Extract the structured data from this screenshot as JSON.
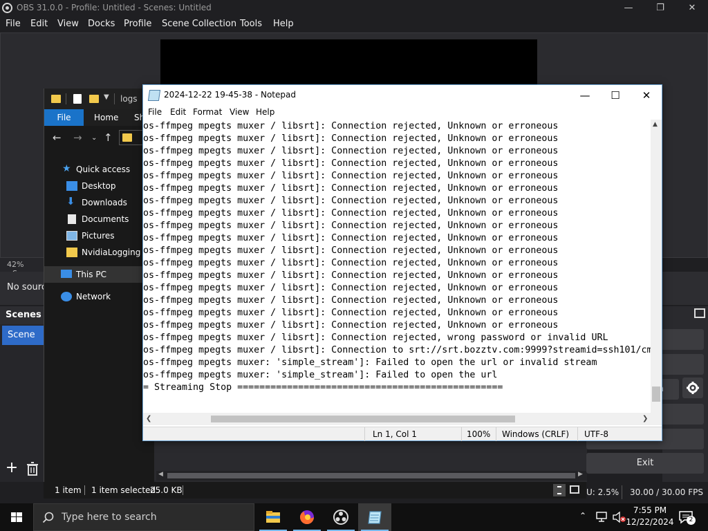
{
  "obs": {
    "title": "OBS 31.0.0 - Profile: Untitled - Scenes: Untitled",
    "menu": [
      "File",
      "Edit",
      "View",
      "Docks",
      "Profile",
      "Scene Collection",
      "Tools",
      "Help"
    ],
    "zoom": "42%",
    "zoom_suffix": "Sca",
    "no_source": "No sourc",
    "scenes_header": "Scenes",
    "scene_item": "Scene",
    "controls": {
      "btn1": "g",
      "btn2": "g",
      "btn3": "a",
      "exit": "Exit"
    },
    "status": {
      "cpu": "U: 2.5%",
      "fps": "30.00 / 30.00 FPS"
    }
  },
  "explorer": {
    "path": "logs",
    "tabs": {
      "file": "File",
      "home": "Home",
      "share": "Sh"
    },
    "nav": [
      {
        "label": "Quick access",
        "icon": "star-icon"
      },
      {
        "label": "Desktop",
        "icon": "desktop-icon"
      },
      {
        "label": "Downloads",
        "icon": "download-icon"
      },
      {
        "label": "Documents",
        "icon": "document-icon"
      },
      {
        "label": "Pictures",
        "icon": "picture-icon"
      },
      {
        "label": "NvidiaLogging",
        "icon": "folder-icon"
      },
      {
        "label": "This PC",
        "icon": "computer-icon"
      },
      {
        "label": "Network",
        "icon": "network-icon"
      }
    ],
    "status": {
      "count": "1 item",
      "selected": "1 item selected",
      "size": "25.0 KB"
    }
  },
  "notepad": {
    "title": "2024-12-22 19-45-38 - Notepad",
    "menu": [
      "File",
      "Edit",
      "Format",
      "View",
      "Help"
    ],
    "lines": [
      "os-ffmpeg mpegts muxer / libsrt]: Connection rejected, Unknown or erroneous",
      "os-ffmpeg mpegts muxer / libsrt]: Connection rejected, Unknown or erroneous",
      "os-ffmpeg mpegts muxer / libsrt]: Connection rejected, Unknown or erroneous",
      "os-ffmpeg mpegts muxer / libsrt]: Connection rejected, Unknown or erroneous",
      "os-ffmpeg mpegts muxer / libsrt]: Connection rejected, Unknown or erroneous",
      "os-ffmpeg mpegts muxer / libsrt]: Connection rejected, Unknown or erroneous",
      "os-ffmpeg mpegts muxer / libsrt]: Connection rejected, Unknown or erroneous",
      "os-ffmpeg mpegts muxer / libsrt]: Connection rejected, Unknown or erroneous",
      "os-ffmpeg mpegts muxer / libsrt]: Connection rejected, Unknown or erroneous",
      "os-ffmpeg mpegts muxer / libsrt]: Connection rejected, Unknown or erroneous",
      "os-ffmpeg mpegts muxer / libsrt]: Connection rejected, Unknown or erroneous",
      "os-ffmpeg mpegts muxer / libsrt]: Connection rejected, Unknown or erroneous",
      "os-ffmpeg mpegts muxer / libsrt]: Connection rejected, Unknown or erroneous",
      "os-ffmpeg mpegts muxer / libsrt]: Connection rejected, Unknown or erroneous",
      "os-ffmpeg mpegts muxer / libsrt]: Connection rejected, Unknown or erroneous",
      "os-ffmpeg mpegts muxer / libsrt]: Connection rejected, Unknown or erroneous",
      "os-ffmpeg mpegts muxer / libsrt]: Connection rejected, Unknown or erroneous",
      "os-ffmpeg mpegts muxer / libsrt]: Connection rejected, wrong password or invalid URL",
      "os-ffmpeg mpegts muxer / libsrt]: Connection to srt://srt.bozztv.com:9999?streamid=ssh101/cm",
      "os-ffmpeg mpegts muxer: 'simple_stream']: Failed to open the url or invalid stream",
      "os-ffmpeg mpegts muxer: 'simple_stream']: Failed to open the url",
      "= Streaming Stop ================================================"
    ],
    "status": {
      "position": "Ln 1, Col 1",
      "zoom": "100%",
      "line_ending": "Windows (CRLF)",
      "encoding": "UTF-8"
    }
  },
  "taskbar": {
    "search_placeholder": "Type here to search",
    "time": "7:55 PM",
    "date": "12/22/2024",
    "notifications": "2"
  }
}
